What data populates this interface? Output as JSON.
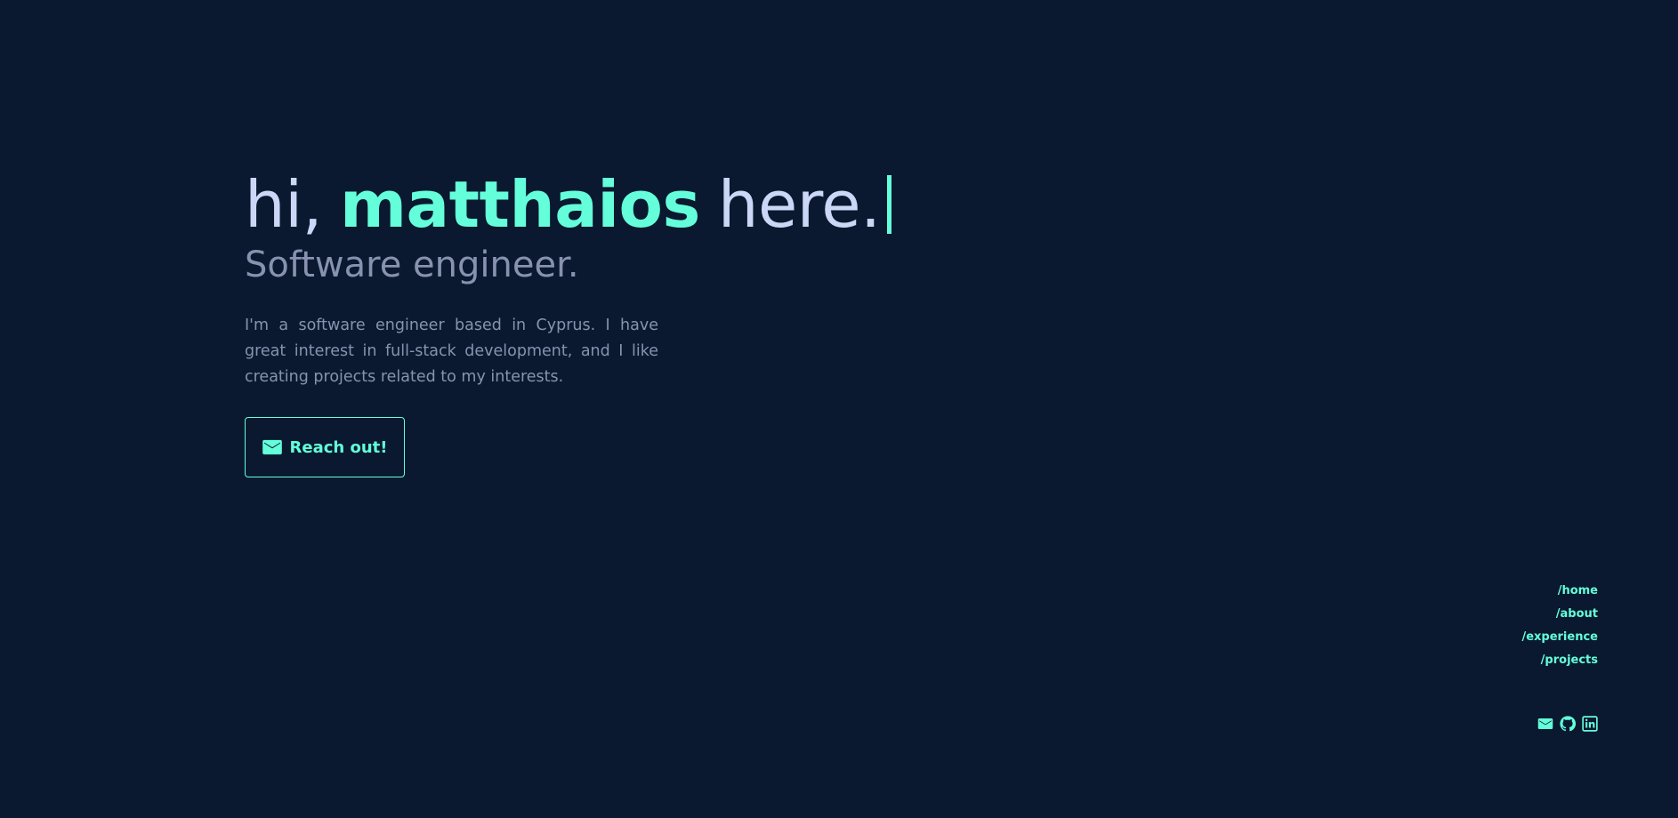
{
  "hero": {
    "greeting_prefix": "hi,",
    "name": "matthaios",
    "greeting_suffix": "here.",
    "subtitle": "Software engineer.",
    "bio": "I'm a software engineer based in Cyprus. I have great interest in full-stack development, and I like creating projects related to my interests.",
    "cta_label": "Reach out!",
    "cta_icon": "mail-icon"
  },
  "nav": {
    "items": [
      {
        "label": "/home"
      },
      {
        "label": "/about"
      },
      {
        "label": "/experience"
      },
      {
        "label": "/projects"
      }
    ]
  },
  "socials": {
    "icons": [
      "mail-icon",
      "github-icon",
      "linkedin-icon"
    ]
  },
  "colors": {
    "background": "#0a192f",
    "accent": "#64ffda",
    "heading": "#ccd6f6",
    "body_text": "#8892b0"
  }
}
